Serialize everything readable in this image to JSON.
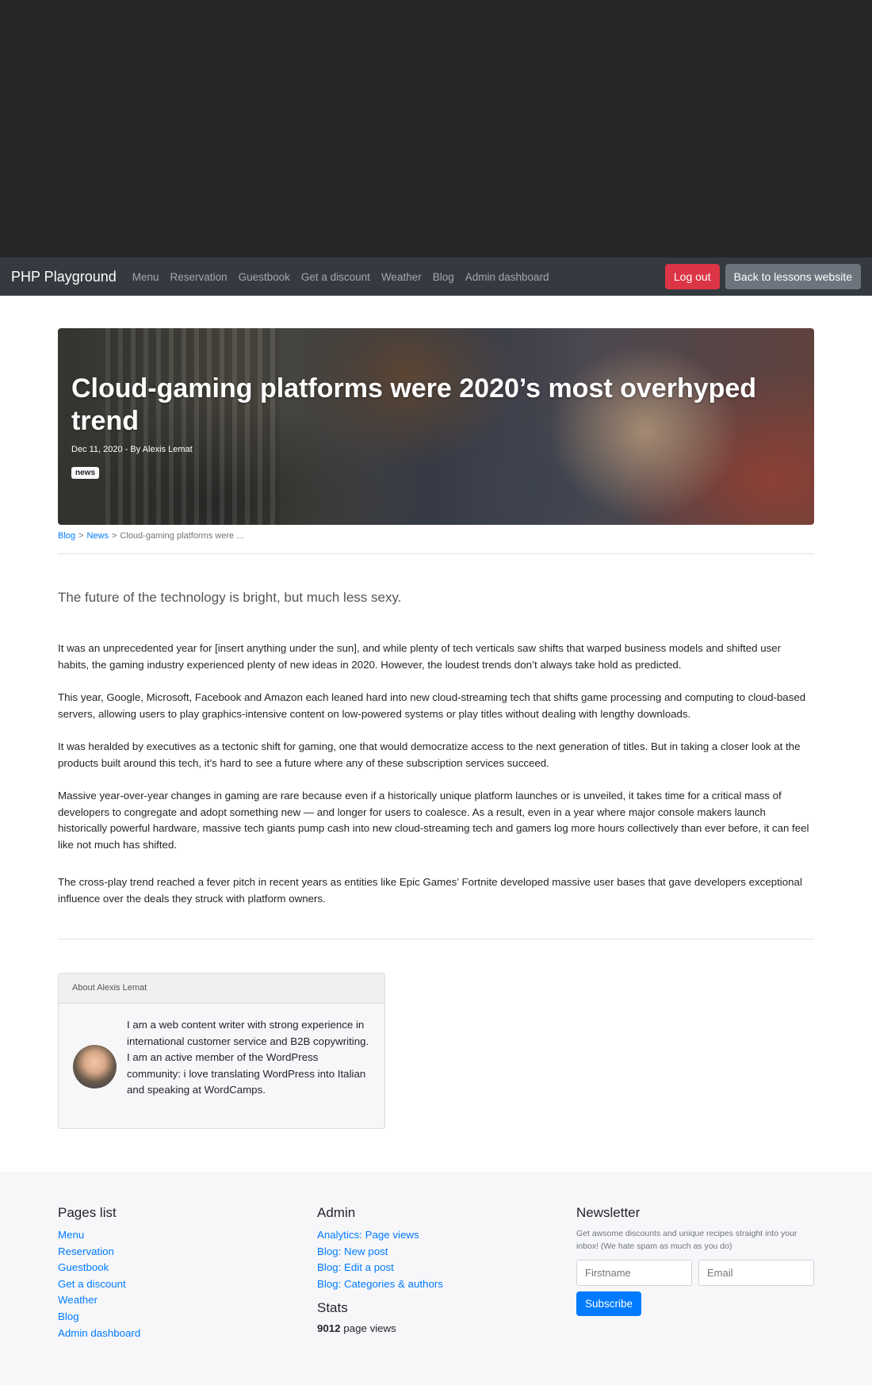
{
  "navbar": {
    "brand": "PHP Playground",
    "links": [
      "Menu",
      "Reservation",
      "Guestbook",
      "Get a discount",
      "Weather",
      "Blog",
      "Admin dashboard"
    ],
    "logout_label": "Log out",
    "back_label": "Back to lessons website"
  },
  "hero": {
    "title": "Cloud-gaming platforms were 2020’s most overhyped trend",
    "meta": "Dec 11, 2020 - By Alexis Lemat",
    "badge": "news"
  },
  "breadcrumb": {
    "items": [
      "Blog",
      "News"
    ],
    "current": "Cloud-gaming platforms were ...",
    "separator": ">"
  },
  "article": {
    "lead": "The future of the technology is bright, but much less sexy.",
    "paragraphs": [
      "It was an unprecedented year for [insert anything under the sun], and while plenty of tech verticals saw shifts that warped business models and shifted user habits, the gaming industry experienced plenty of new ideas in 2020. However, the loudest trends don’t always take hold as predicted.",
      "This year, Google, Microsoft, Facebook and Amazon each leaned hard into new cloud-streaming tech that shifts game processing and computing to cloud-based servers, allowing users to play graphics-intensive content on low-powered systems or play titles without dealing with lengthy downloads.",
      "It was heralded by executives as a tectonic shift for gaming, one that would democratize access to the next generation of titles. But in taking a closer look at the products built around this tech, it’s hard to see a future where any of these subscription services succeed.",
      "Massive year-over-year changes in gaming are rare because even if a historically unique platform launches or is unveiled, it takes time for a critical mass of developers to congregate and adopt something new — and longer for users to coalesce. As a result, even in a year where major console makers launch historically powerful hardware, massive tech giants pump cash into new cloud-streaming tech and gamers log more hours collectively than ever before, it can feel like not much has shifted.",
      "The cross-play trend reached a fever pitch in recent years as entities like Epic Games’ Fortnite developed massive user bases that gave developers exceptional influence over the deals they struck with platform owners."
    ]
  },
  "author": {
    "header": "About Alexis Lemat",
    "bio": "I am a web content writer with strong experience in international customer service and B2B copywriting. I am an active member of the WordPress community: i love translating WordPress into Italian and speaking at WordCamps."
  },
  "footer": {
    "pages_title": "Pages list",
    "pages": [
      "Menu",
      "Reservation",
      "Guestbook",
      "Get a discount",
      "Weather",
      "Blog",
      "Admin dashboard"
    ],
    "admin_title": "Admin",
    "admin_links": [
      "Analytics: Page views",
      "Blog: New post",
      "Blog: Edit a post",
      "Blog: Categories & authors"
    ],
    "stats_title": "Stats",
    "stats_count": "9012",
    "stats_suffix": " page views",
    "newsletter_title": "Newsletter",
    "newsletter_desc": "Get awsome discounts and unique recipes straight into your inbox! (We hate spam as much as you do)",
    "firstname_placeholder": "Firstname",
    "email_placeholder": "Email",
    "subscribe_label": "Subscribe"
  }
}
